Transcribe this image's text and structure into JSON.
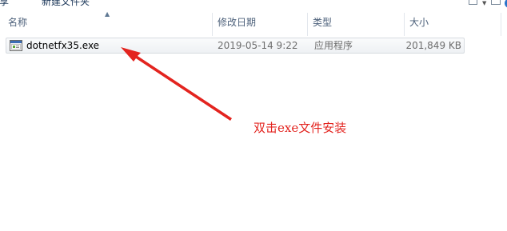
{
  "toolbar": {
    "clipped_left_text": "享",
    "new_folder_label": "新建文件夹",
    "view_icon": "view-options-icon",
    "pane_icon": "preview-pane-icon",
    "help_icon": "help-icon",
    "help_glyph": "?"
  },
  "columns": {
    "name": "名称",
    "date_modified": "修改日期",
    "type": "类型",
    "size": "大小"
  },
  "files": [
    {
      "name": "dotnetfx35.exe",
      "date_modified": "2019-05-14 9:22",
      "type": "应用程序",
      "size": "201,849 KB",
      "icon": "exe-installer-icon"
    }
  ],
  "annotation": {
    "text": "双击exe文件安装",
    "color": "#e3241f"
  }
}
